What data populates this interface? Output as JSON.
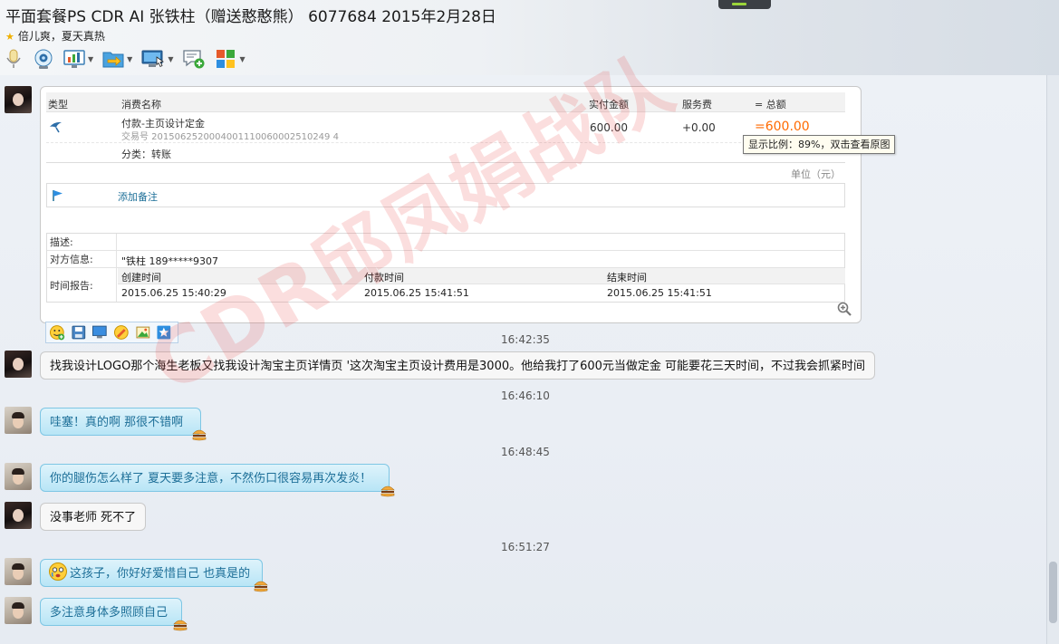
{
  "window": {
    "title": "平面套餐PS CDR AI 张铁柱（赠送憨憨熊）   6077684  2015年2月28日",
    "signature": "倍儿爽，夏天真热"
  },
  "toolbar": {
    "icons": [
      "microphone-icon",
      "video-camera-icon",
      "screen-share-icon",
      "file-transfer-icon",
      "remote-desktop-icon",
      "new-message-icon",
      "apps-icon"
    ]
  },
  "transaction": {
    "headers": {
      "type": "类型",
      "name": "消费名称",
      "amount": "实付金额",
      "fee": "服务费",
      "total": "= 总额"
    },
    "item": {
      "name": "付款-主页设计定金",
      "serial": "交易号 2015062520004001110060002510249 4",
      "amount": "600.00",
      "fee": "+0.00",
      "total": "=600.00"
    },
    "category": "分类：转账",
    "unit": "单位（元）",
    "add_remark": "添加备注",
    "desc_label": "描述:",
    "counterparty_label": "对方信息:",
    "counterparty": "\"铁柱 189*****9307",
    "time_label": "时间报告:",
    "times": {
      "created_label": "创建时间",
      "created": "2015.06.25 15:40:29",
      "paid_label": "付款时间",
      "paid": "2015.06.25 15:41:51",
      "finished_label": "结束时间",
      "finished": "2015.06.25 15:41:51"
    },
    "tooltip": "显示比例：89%，双击查看原图"
  },
  "messages": {
    "t1": "16:42:35",
    "m1": "找我设计LOGO那个海生老板又找我设计淘宝主页详情页  '这次淘宝主页设计费用是3000。他给我打了600元当做定金  可能要花三天时间，不过我会抓紧时间",
    "t2": "16:46:10",
    "m2": "哇塞！真的啊  那很不错啊",
    "t3": "16:48:45",
    "m3": "你的腿伤怎么样了  夏天要多注意，不然伤口很容易再次发炎！",
    "m4": "没事老师  死不了",
    "t4": "16:51:27",
    "m5": "这孩子，你好好爱惜自己 也真是的",
    "m6": "多注意身体多照顾自己"
  },
  "watermark": "CDR邱凤娟战队",
  "colors": {
    "accent_blue": "#1d6f98",
    "bubble_blue": "#b8e5f6",
    "total_orange": "#ff6a00",
    "watermark_red": "#e63c3c"
  }
}
